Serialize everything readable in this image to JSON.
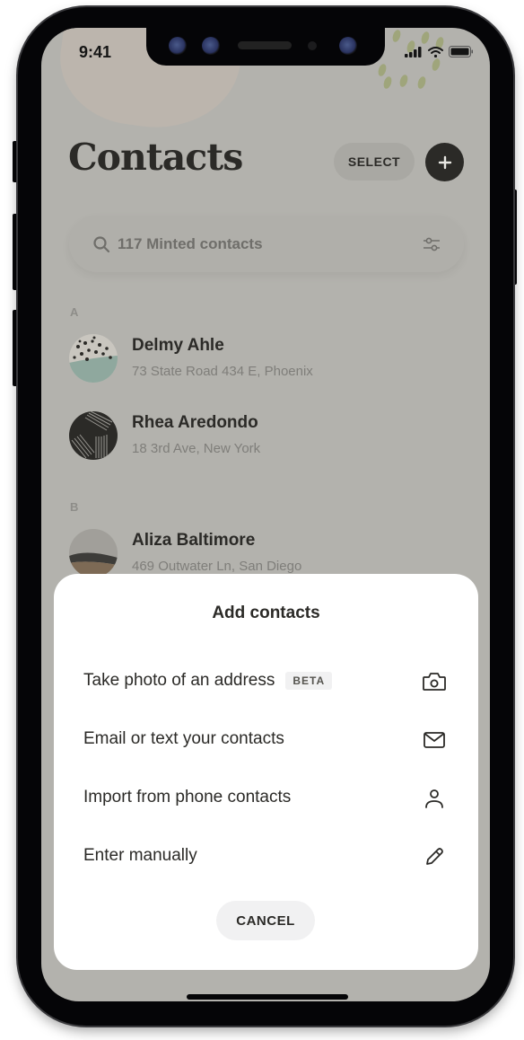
{
  "status_bar": {
    "time": "9:41",
    "icons": [
      "cellular-signal-icon",
      "wifi-icon",
      "battery-icon"
    ]
  },
  "header": {
    "title": "Contacts",
    "select_label": "SELECT",
    "add_icon": "plus-icon"
  },
  "search": {
    "placeholder": "117 Minted contacts",
    "icon": "search-icon",
    "filter_icon": "sliders-icon"
  },
  "contacts": {
    "sections": [
      {
        "letter": "A",
        "items": [
          {
            "name": "Delmy Ahle",
            "address": "73 State Road 434 E, Phoenix"
          },
          {
            "name": "Rhea Aredondo",
            "address": "18 3rd Ave, New York"
          }
        ]
      },
      {
        "letter": "B",
        "items": [
          {
            "name": "Aliza Baltimore",
            "address": "469 Outwater Ln, San Diego"
          }
        ]
      }
    ]
  },
  "sheet": {
    "title": "Add contacts",
    "options": [
      {
        "label": "Take photo of an address",
        "badge": "BETA",
        "icon": "camera-icon"
      },
      {
        "label": "Email or text your contacts",
        "icon": "envelope-icon"
      },
      {
        "label": "Import from phone contacts",
        "icon": "person-icon"
      },
      {
        "label": "Enter manually",
        "icon": "pencil-icon"
      }
    ],
    "cancel_label": "CANCEL"
  },
  "colors": {
    "overlay_background": "#b3b2ad",
    "primary_text": "#2b2a27",
    "sheet_background": "#ffffff",
    "button_background": "#f1f1f2",
    "accent_dark": "#2b2a27"
  }
}
